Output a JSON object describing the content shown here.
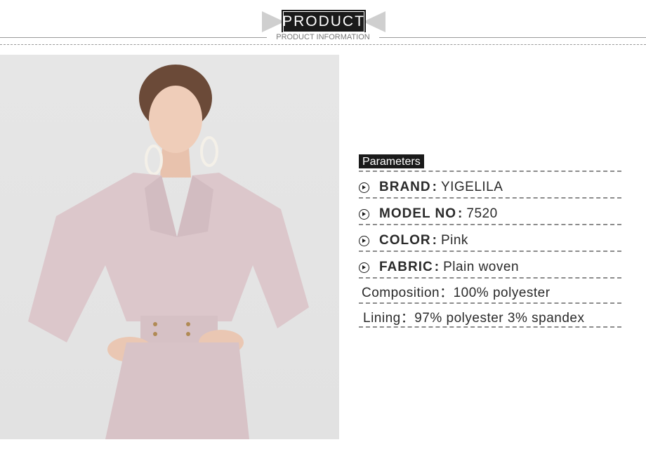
{
  "header": {
    "badge": "PRODUCT",
    "subtitle": "PRODUCT INFORMATION"
  },
  "photo": {
    "description_icon": "model-photo"
  },
  "parameters": {
    "title": "Parameters",
    "rows": [
      {
        "label": "BRAND",
        "colon": ":",
        "value": "YIGELILA"
      },
      {
        "label": "MODEL NO",
        "colon": ":",
        "value": "7520"
      },
      {
        "label": "COLOR",
        "colon": ":",
        "value": "Pink"
      },
      {
        "label": "FABRIC",
        "colon": ":",
        "value": "Plain woven"
      }
    ],
    "composition": "Composition：100% polyester",
    "lining": "Lining：97% polyester 3% spandex"
  },
  "colors": {
    "accent": "#1a1a1a",
    "dress": "#dcc7cb",
    "background": "#e4e4e4"
  }
}
